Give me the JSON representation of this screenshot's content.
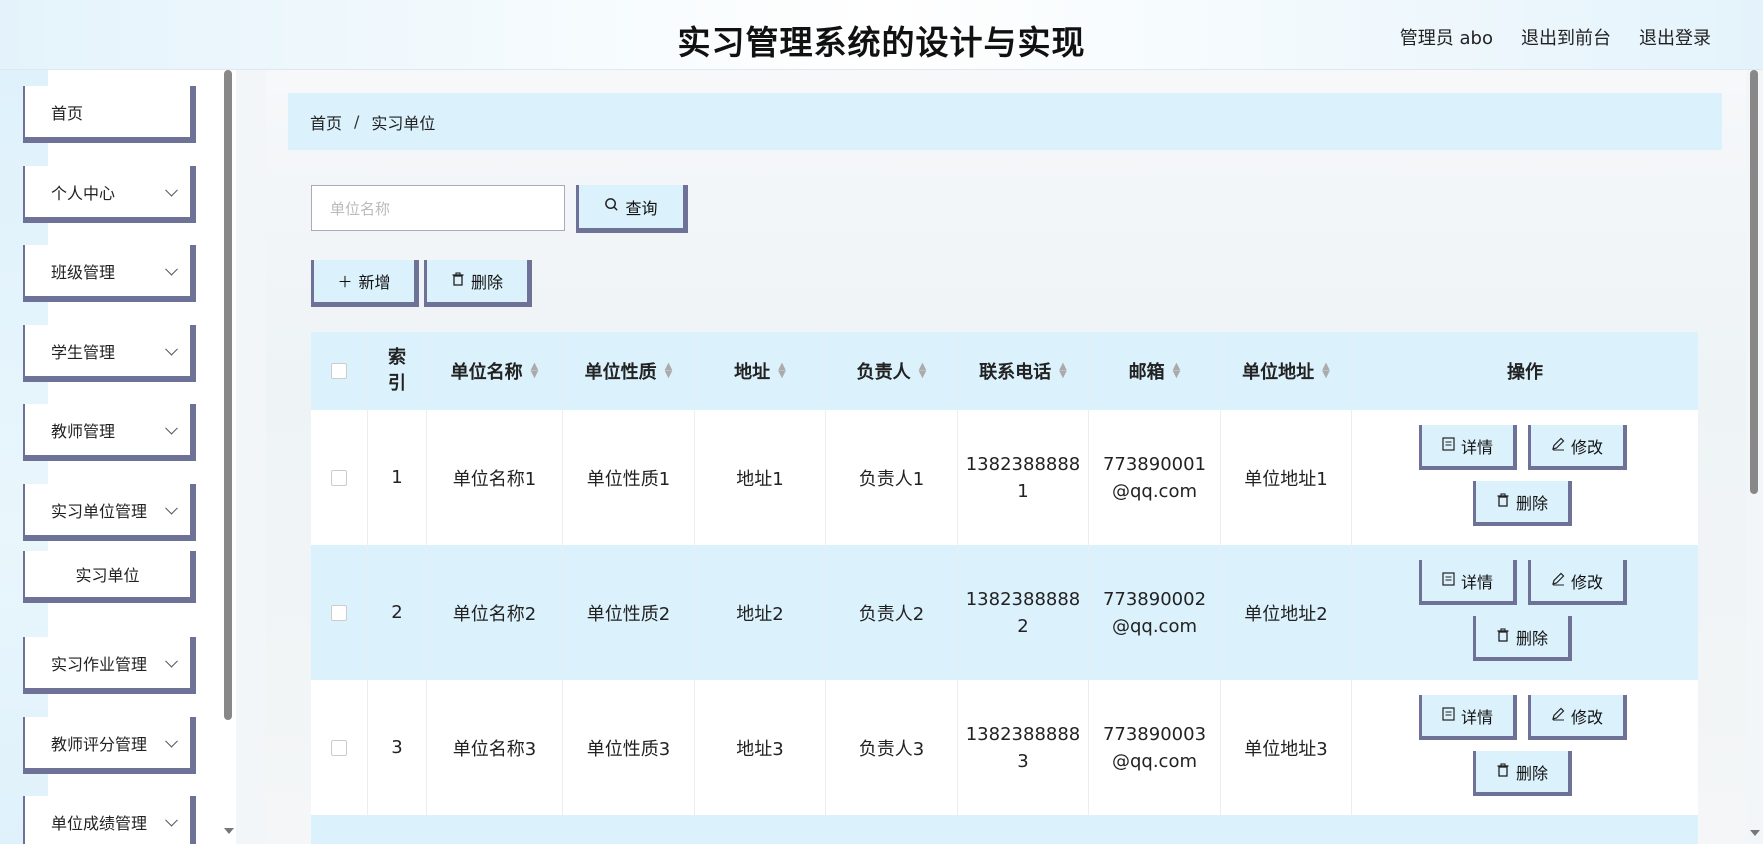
{
  "header": {
    "title": "实习管理系统的设计与实现",
    "user": "管理员 abo",
    "to_front": "退出到前台",
    "logout": "退出登录"
  },
  "sidebar": {
    "items": [
      {
        "label": "首页",
        "expandable": false
      },
      {
        "label": "个人中心",
        "expandable": true
      },
      {
        "label": "班级管理",
        "expandable": true
      },
      {
        "label": "学生管理",
        "expandable": true
      },
      {
        "label": "教师管理",
        "expandable": true
      },
      {
        "label": "实习单位管理",
        "expandable": true
      },
      {
        "label": "实习单位",
        "expandable": false,
        "sub": true
      },
      {
        "label": "实习作业管理",
        "expandable": true
      },
      {
        "label": "教师评分管理",
        "expandable": true
      },
      {
        "label": "单位成绩管理",
        "expandable": true
      }
    ]
  },
  "breadcrumb": {
    "home": "首页",
    "separator": "/",
    "current": "实习单位"
  },
  "search": {
    "placeholder": "单位名称",
    "button": "查询"
  },
  "toolbar": {
    "add": "新增",
    "delete": "删除"
  },
  "table": {
    "columns": [
      "索引",
      "单位名称",
      "单位性质",
      "地址",
      "负责人",
      "联系电话",
      "邮箱",
      "单位地址",
      "操作"
    ],
    "rows": [
      {
        "index": "1",
        "name": "单位名称1",
        "nature": "单位性质1",
        "address": "地址1",
        "manager": "负责人1",
        "phone_a": "1382388888",
        "phone_b": "1",
        "email_a": "773890001",
        "email_b": "@qq.com",
        "unit_address": "单位地址1"
      },
      {
        "index": "2",
        "name": "单位名称2",
        "nature": "单位性质2",
        "address": "地址2",
        "manager": "负责人2",
        "phone_a": "1382388888",
        "phone_b": "2",
        "email_a": "773890002",
        "email_b": "@qq.com",
        "unit_address": "单位地址2"
      },
      {
        "index": "3",
        "name": "单位名称3",
        "nature": "单位性质3",
        "address": "地址3",
        "manager": "负责人3",
        "phone_a": "1382388888",
        "phone_b": "3",
        "email_a": "773890003",
        "email_b": "@qq.com",
        "unit_address": "单位地址3"
      }
    ],
    "ops": {
      "detail": "详情",
      "edit": "修改",
      "delete": "删除"
    }
  },
  "colors": {
    "accent": "#6e7296",
    "light_blue": "#dbf1fc"
  }
}
